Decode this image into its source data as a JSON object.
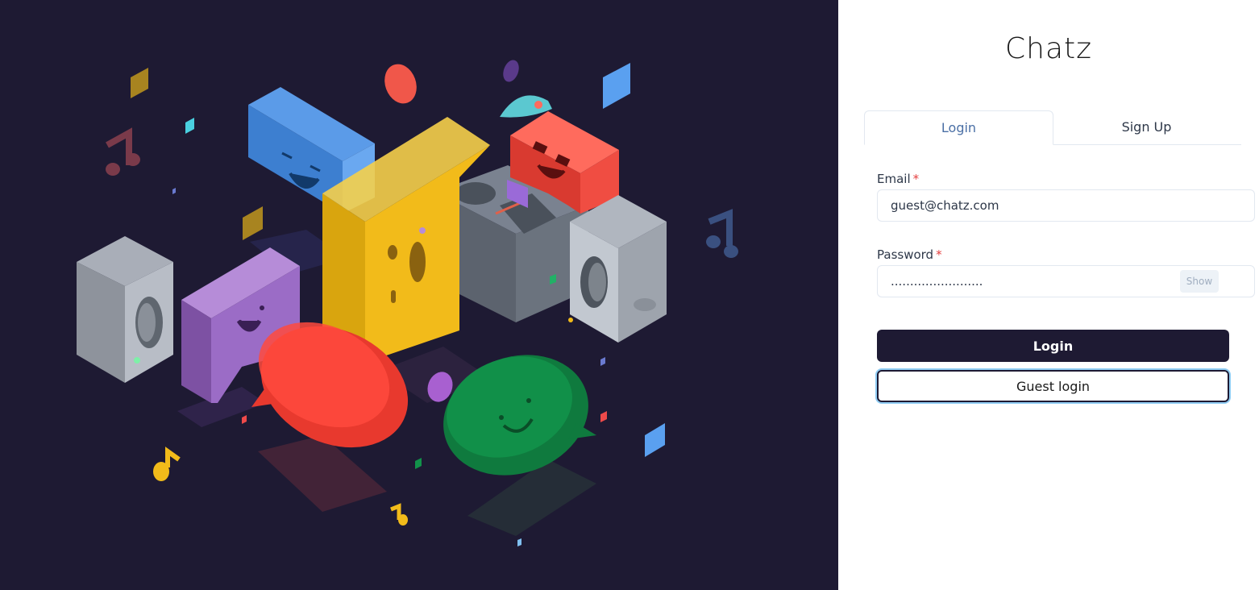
{
  "app": {
    "title": "Chatz"
  },
  "tabs": [
    {
      "label": "Login"
    },
    {
      "label": "Sign Up"
    }
  ],
  "form": {
    "email": {
      "label": "Email",
      "required_mark": "*",
      "value": "guest@chatz.com"
    },
    "password": {
      "label": "Password",
      "required_mark": "*",
      "value": "........................",
      "show_label": "Show"
    },
    "login_label": "Login",
    "guest_label": "Guest login"
  },
  "colors": {
    "hero_bg": "#1e1a33",
    "primary_button": "#1e1a33",
    "active_tab_text": "#4a6fa5",
    "required": "#e53e3e"
  },
  "illustration": {
    "name": "isometric-chat-bubbles-and-speakers"
  }
}
